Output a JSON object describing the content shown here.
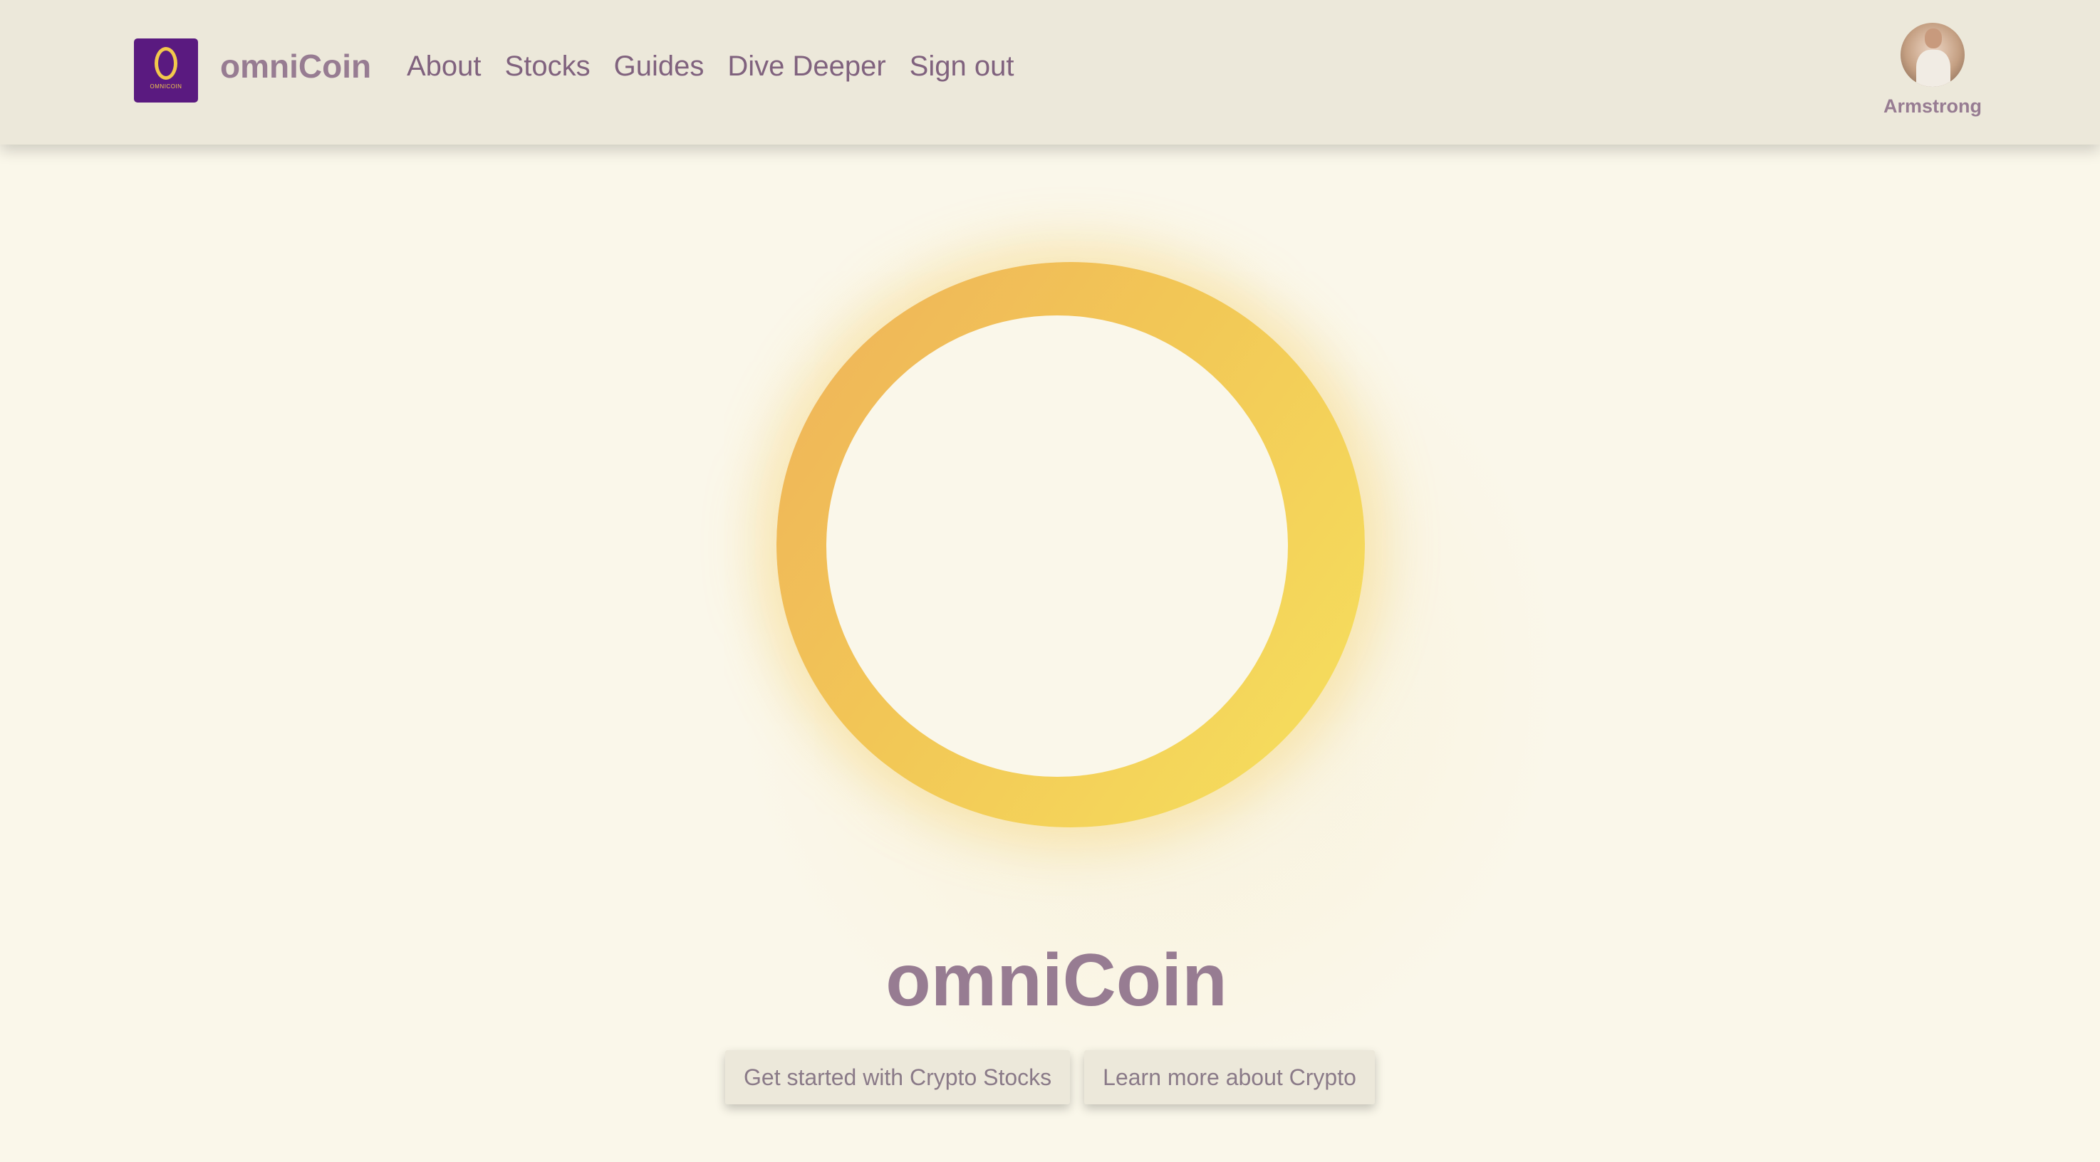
{
  "brand": {
    "logo_text": "OMNICOIN",
    "name": "omniCoin"
  },
  "nav": {
    "links": [
      {
        "label": "About"
      },
      {
        "label": "Stocks"
      },
      {
        "label": "Guides"
      },
      {
        "label": "Dive Deeper"
      },
      {
        "label": "Sign out"
      }
    ]
  },
  "user": {
    "name": "Armstrong"
  },
  "hero": {
    "title": "omniCoin",
    "buttons": [
      {
        "label": "Get started with Crypto Stocks"
      },
      {
        "label": "Learn more about Crypto"
      }
    ]
  },
  "colors": {
    "background": "#faf7ea",
    "navbar": "#ece8da",
    "brand_text": "#977c92",
    "nav_link": "#80627e",
    "logo_bg": "#5a1a80",
    "coin_orange": "#efb25a",
    "coin_yellow": "#f6e15e"
  }
}
